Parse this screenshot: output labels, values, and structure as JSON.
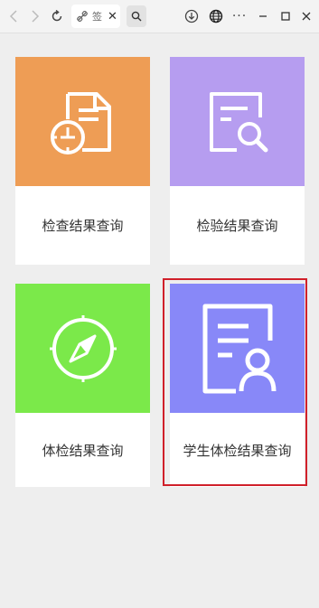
{
  "browser": {
    "tab_label": "签",
    "tab_close": "✕",
    "more": "···"
  },
  "colors": {
    "card1_bg": "#ee9d55",
    "card2_bg": "#b69df0",
    "card3_bg": "#7be94a",
    "card4_bg": "#8888f8",
    "selection_border": "#d0202a"
  },
  "cards": [
    {
      "label": "检查结果查询",
      "icon": "document-clock-icon"
    },
    {
      "label": "检验结果查询",
      "icon": "document-magnifier-icon"
    },
    {
      "label": "体检结果查询",
      "icon": "compass-icon"
    },
    {
      "label": "学生体检结果查询",
      "icon": "document-person-icon"
    }
  ]
}
